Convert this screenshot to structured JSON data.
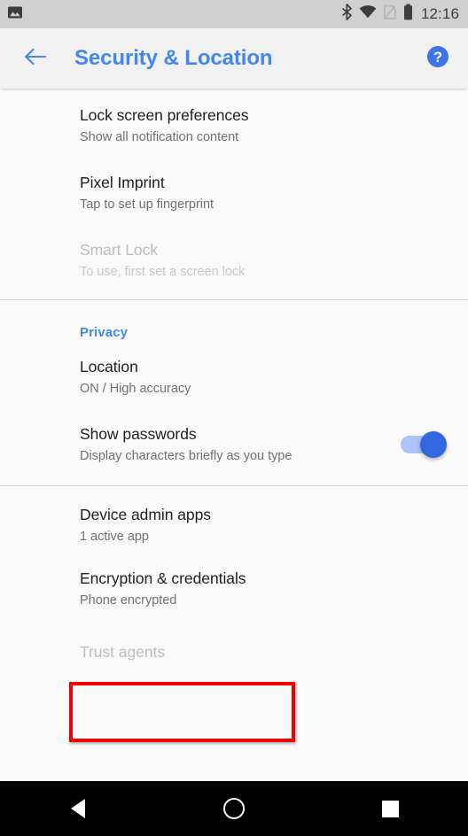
{
  "status_bar": {
    "notification_icon": "image-screenshot-icon",
    "icons": [
      "bluetooth-icon",
      "wifi-icon",
      "no-sim-icon",
      "battery-icon"
    ],
    "time": "12:16"
  },
  "app_bar": {
    "back_icon": "back-arrow-icon",
    "title": "Security & Location",
    "help_icon": "help-circle-icon"
  },
  "colors": {
    "accent": "#4285f4",
    "switch_on": "#3367e0",
    "switch_track": "#aec4f7",
    "highlight": "#ee0000",
    "status_bar_bg": "#d0d0d0",
    "app_bar_bg": "#f1f1f1",
    "content_bg": "#fafafa",
    "nav_bar_bg": "#000000",
    "title_text": "#202124",
    "subtitle_text": "#6e7175",
    "disabled_text": "#bdbdbd"
  },
  "sections": [
    {
      "name": "security",
      "header": null,
      "items": [
        {
          "title": "Lock screen preferences",
          "subtitle": "Show all notification content",
          "disabled": false,
          "has_switch": false
        },
        {
          "title": "Pixel Imprint",
          "subtitle": "Tap to set up fingerprint",
          "disabled": false,
          "has_switch": false
        },
        {
          "title": "Smart Lock",
          "subtitle": "To use, first set a screen lock",
          "disabled": true,
          "has_switch": false
        }
      ]
    },
    {
      "name": "privacy",
      "header": "Privacy",
      "items": [
        {
          "title": "Location",
          "subtitle": "ON / High accuracy",
          "disabled": false,
          "has_switch": false
        },
        {
          "title": "Show passwords",
          "subtitle": "Display characters briefly as you type",
          "disabled": false,
          "has_switch": true,
          "switch_on": true
        }
      ]
    },
    {
      "name": "device-admin",
      "header": null,
      "items": [
        {
          "title": "Device admin apps",
          "subtitle": "1 active app",
          "disabled": false,
          "has_switch": false
        },
        {
          "title": "Encryption & credentials",
          "subtitle": "Phone encrypted",
          "disabled": false,
          "has_switch": false,
          "highlighted": true
        },
        {
          "title": "Trust agents",
          "subtitle": "",
          "disabled": true,
          "has_switch": false
        }
      ]
    }
  ],
  "nav_bar": {
    "back_label": "back-triangle-icon",
    "home_label": "home-circle-icon",
    "recents_label": "recents-square-icon"
  }
}
